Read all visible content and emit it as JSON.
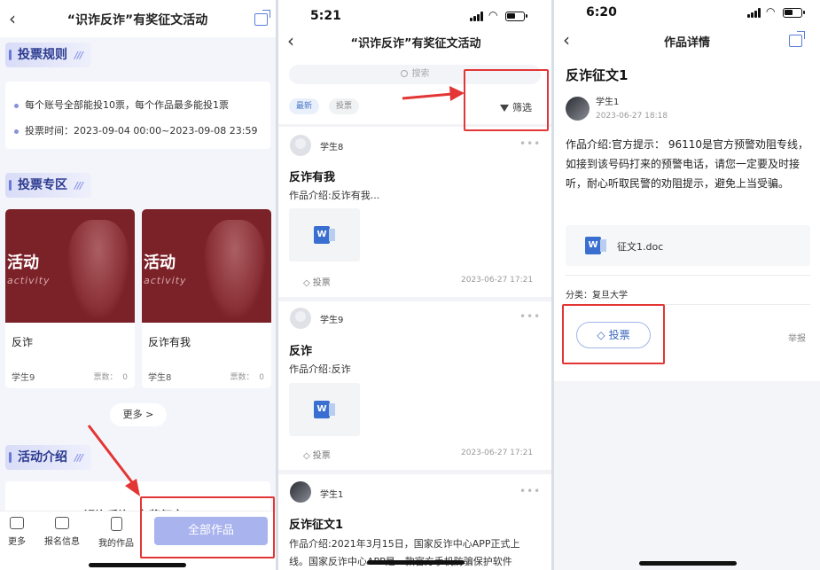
{
  "panel1": {
    "title": "“识诈反诈”有奖征文活动",
    "rules_heading": "投票规则",
    "rules": [
      "每个账号全部能投10票，每个作品最多能投1票",
      "投票时间：2023-09-04 00:00~2023-09-08 23:59"
    ],
    "zone_heading": "投票专区",
    "works": [
      {
        "banner_big": "活动",
        "banner_small": "activity",
        "name": "反诈",
        "author": "学生9",
        "votes_label": "票数：",
        "votes": "0"
      },
      {
        "banner_big": "活动",
        "banner_small": "activity",
        "name": "反诈有我",
        "author": "学生8",
        "votes_label": "票数：",
        "votes": "0"
      }
    ],
    "more_label": "更多 >",
    "intro_heading": "活动介绍",
    "intro_peek": "“识诈反诈”有奖征文",
    "tabs": [
      {
        "label": "更多",
        "icon": "more-icon"
      },
      {
        "label": "报名信息",
        "icon": "profile-card-icon"
      },
      {
        "label": "我的作品",
        "icon": "document-icon"
      }
    ],
    "all_works_label": "全部作品"
  },
  "panel2": {
    "time": "5:21",
    "title": "“识诈反诈”有奖征文活动",
    "search_placeholder": "搜索",
    "chips": [
      "最新",
      "投票"
    ],
    "filter_label": "筛选",
    "posts": [
      {
        "user": "学生8",
        "title": "反诈有我",
        "desc": "作品介绍:反诈有我...",
        "vote": "投票",
        "date": "2023-06-27 17:21"
      },
      {
        "user": "学生9",
        "title": "反诈",
        "desc": "作品介绍:反诈",
        "vote": "投票",
        "date": "2023-06-27 17:21"
      },
      {
        "user": "学生1",
        "title": "反诈征文1",
        "desc1": "作品介绍:2021年3月15日，国家反诈中心APP正式上",
        "desc2": "线。国家反诈中心APP是一款官方手机防骗保护软件"
      }
    ],
    "word_icon": "W"
  },
  "panel3": {
    "time": "6:20",
    "title": "作品详情",
    "work_title": "反诈征文1",
    "author": "学生1",
    "date": "2023-06-27 18:18",
    "intro": "作品介绍:官方提示： 96110是官方预警劝阻专线，如接到该号码打来的预警电话，请您一定要及时接听，耐心听取民警的劝阻提示，避免上当受骗。",
    "file_name": "征文1.doc",
    "category": "分类：复旦大学",
    "vote_label": "投票",
    "report_label": "举报"
  },
  "colors": {
    "highlight": "#e33535",
    "accent": "#4a78c9",
    "banner": "#7b2128"
  }
}
